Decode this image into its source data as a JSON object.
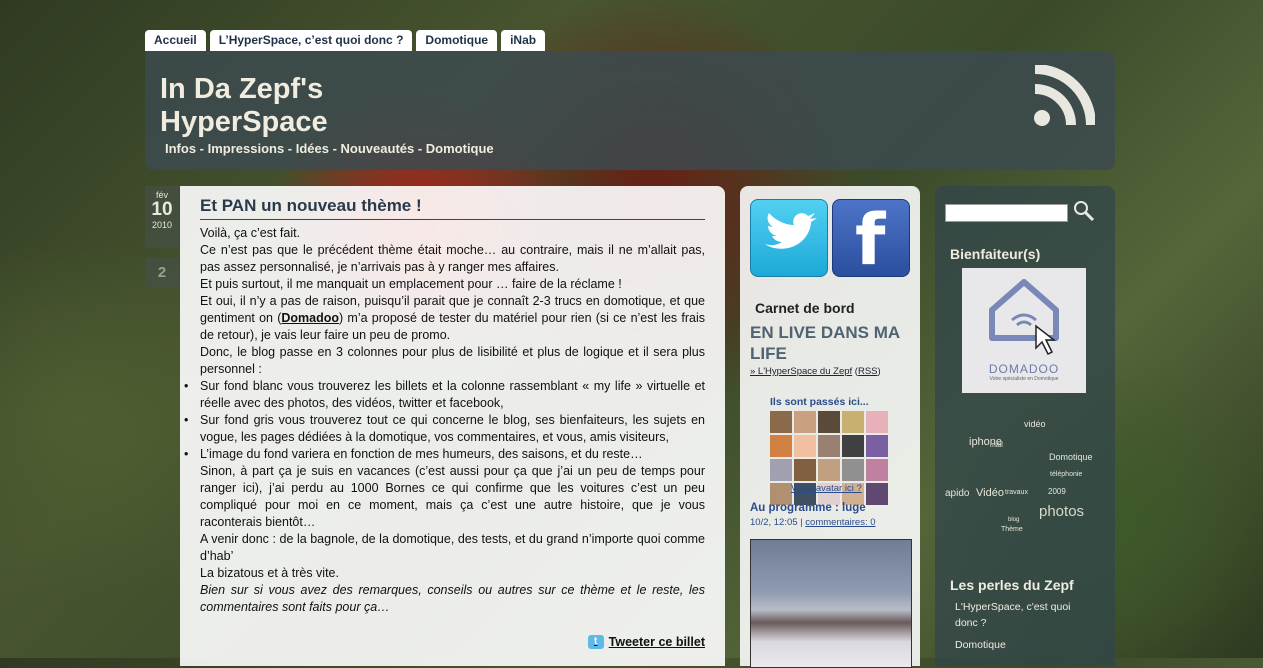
{
  "nav": {
    "tabs": [
      "Accueil",
      "L’HyperSpace, c’est quoi donc ?",
      "Domotique",
      "iNab"
    ]
  },
  "header": {
    "title": "In Da Zepf's HyperSpace",
    "tagline": "Infos - Impressions - Idées - Nouveautés - Domotique",
    "rss_icon": "rss-icon"
  },
  "post": {
    "date": {
      "month": "fév",
      "day": "10",
      "year": "2010"
    },
    "comments_count": "2",
    "title": "Et PAN un nouveau thème !",
    "p1": "Voilà, ça c’est fait.",
    "p2": "Ce n’est pas que le précédent thème était moche… au contraire, mais il ne m’allait pas, pas assez personnalisé, je n’arrivais pas à y ranger mes affaires.",
    "p3": "Et puis surtout, il me manquait un emplacement pour … faire de la réclame !",
    "p4a": "Et oui, il n’y a pas de raison, puisqu’il parait que je connaît 2-3 trucs en domotique, et que gentiment on (",
    "p4link": "Domadoo",
    "p4b": ") m’a proposé de tester du matériel pour rien (si ce n’est les frais de retour), je vais leur faire un peu de promo.",
    "p5": "Donc, le blog passe en 3 colonnes pour plus de lisibilité et plus de logique et il sera plus personnel :",
    "li1": "Sur fond blanc vous trouverez les billets et la colonne rassemblant « my life » virtuelle et réelle avec des photos, des vidéos, twitter et facebook,",
    "li2": "Sur fond gris vous trouverez tout ce qui concerne le blog, ses bienfaiteurs, les sujets en vogue, les pages dédiées à la domotique, vos commentaires, et vous, amis visiteurs,",
    "li3": "L’image du fond variera en fonction de mes humeurs, des saisons, et du reste…",
    "p6": "Sinon, à part ça je suis en vacances (c’est aussi pour ça que j’ai un peu de temps pour ranger ici), j’ai perdu au 1000 Bornes ce qui confirme que les voitures c’est un peu compliqué pour moi en ce moment, mais ça c’est une autre histoire, que je vous raconterais bientôt…",
    "p7": "A venir donc : de la bagnole, de la domotique, des tests, et du grand n’importe quoi comme d’hab’",
    "p8": "La bizatous et à très vite.",
    "p9": "Bien sur si vous avez des remarques, conseils ou autres sur ce thème et le reste, les commentaires sont faits pour ça…",
    "tweet": "Tweeter ce billet"
  },
  "middle": {
    "carnet": "Carnet de bord",
    "live": "EN LIVE DANS MA LIFE",
    "hyper_link": "» L'HyperSpace du Zepf",
    "rss": "RSS",
    "passes": "Ils sont passés ici...",
    "avatar_colors": [
      "#8a6a4a",
      "#c9a080",
      "#5a4a3a",
      "#c8b070",
      "#e8b0b8",
      "#d08040",
      "#f0c0a0",
      "#9a8070",
      "#404040",
      "#7a60a0",
      "#a0a0b0",
      "#806040",
      "#c0a080",
      "#909090",
      "#c080a0",
      "#b09070",
      "#405060",
      "#e0d0d0",
      "#d0b090",
      "#604870"
    ],
    "votre": "Votre avatar ici ?",
    "prog_title": "Au programme : luge",
    "prog_date": "10/2, 12:05",
    "prog_comments": "commentaires: 0"
  },
  "right": {
    "bienfaiteurs": "Bienfaiteur(s)",
    "domadoo_name": "DOMADOO",
    "domadoo_sub": "Votre spécialiste en Domotique",
    "tags": [
      "vidéo",
      "iphone",
      "mail",
      "Domotique",
      "téléphonie",
      "apido",
      "Vidéo",
      "travaux",
      "2009",
      "photos",
      "blog",
      "Thème"
    ],
    "perles": "Les perles du Zepf",
    "perles_links": [
      "L'HyperSpace, c'est quoi donc ?",
      "Domotique"
    ]
  }
}
